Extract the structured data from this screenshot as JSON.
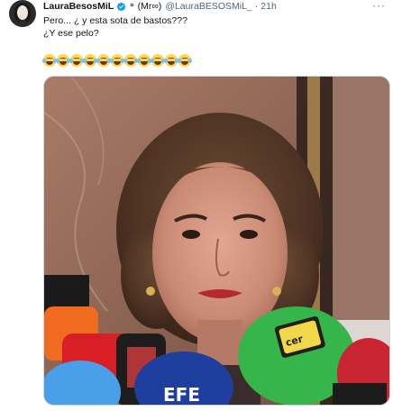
{
  "tweet": {
    "display_name": "LauraBesosMiL",
    "name_suffix": "(Mr∞)",
    "handle": "@LauraBESOSMiL_",
    "separator": "·",
    "time": "21h",
    "more_label": "···",
    "lines": [
      "Pero... ¿ y esta sota de bastos???",
      "¿Y ese pelo?"
    ],
    "emoji_count": 11,
    "emoji_name": "face-with-tears-of-joy",
    "media_alt": "photo"
  },
  "icons": {
    "avatar": "avatar",
    "verified": "verified-badge-icon",
    "ring": "ring-icon",
    "more": "more-options-icon"
  },
  "colors": {
    "text": "#0f1419",
    "secondary": "#536471",
    "verified": "#1d9bf0",
    "border": "#cfd9de"
  }
}
